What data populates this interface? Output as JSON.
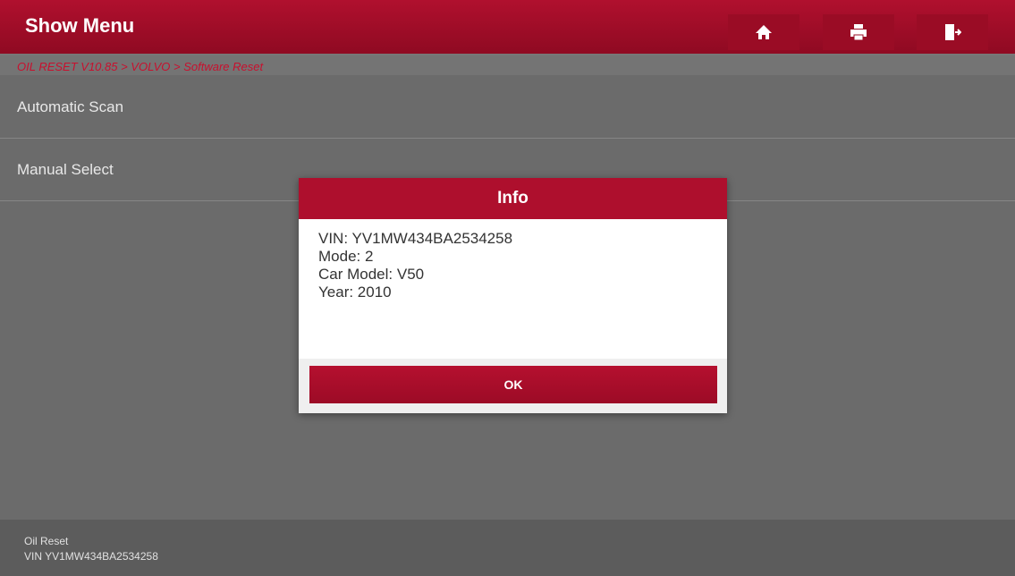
{
  "header": {
    "title": "Show Menu",
    "icons": {
      "home": "home-icon",
      "print": "print-icon",
      "exit": "exit-icon"
    }
  },
  "breadcrumb": "OIL RESET V10.85 > VOLVO > Software Reset",
  "menu": {
    "items": [
      {
        "label": "Automatic Scan"
      },
      {
        "label": "Manual Select"
      }
    ]
  },
  "dialog": {
    "title": "Info",
    "lines": [
      "VIN: YV1MW434BA2534258",
      "Mode: 2",
      "Car Model: V50",
      "Year: 2010"
    ],
    "ok_label": "OK"
  },
  "footer": {
    "line1": "Oil Reset",
    "line2": "VIN YV1MW434BA2534258"
  },
  "colors": {
    "brand_red": "#ae0f2d",
    "background": "#6b6b6b"
  }
}
